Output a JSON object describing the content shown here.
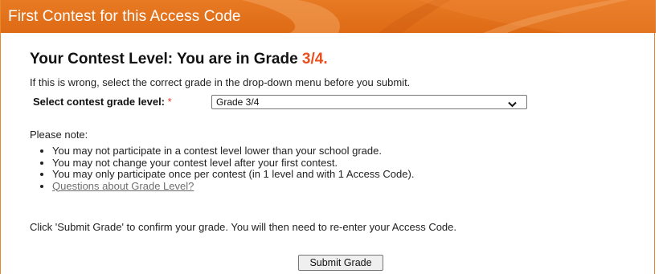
{
  "header": {
    "title": "First Contest for this Access Code"
  },
  "level": {
    "heading_prefix": "Your Contest Level: You are in Grade ",
    "grade": "3/4.",
    "hint": "If this is wrong, select the correct grade in the drop-down menu before you submit."
  },
  "grade_select": {
    "label": "Select contest grade level:",
    "required_mark": "*",
    "selected_value": "Grade 3/4",
    "icon": "chevron-down-icon"
  },
  "notes": {
    "title": "Please note:",
    "items": [
      "You may not participate in a contest level lower than your school grade.",
      "You may not change your contest level after your first contest.",
      "You may only participate once per contest (in 1 level and with 1 Access Code)."
    ],
    "link": "Questions about Grade Level?"
  },
  "confirm_text": "Click 'Submit Grade' to confirm your grade. You will then need to re-enter your Access Code.",
  "submit_label": "Submit Grade",
  "colors": {
    "header_orange": "#e87a24",
    "grade_accent": "#e8501e",
    "required_red": "#e03a1e",
    "link_gray": "#6e6e6e"
  }
}
